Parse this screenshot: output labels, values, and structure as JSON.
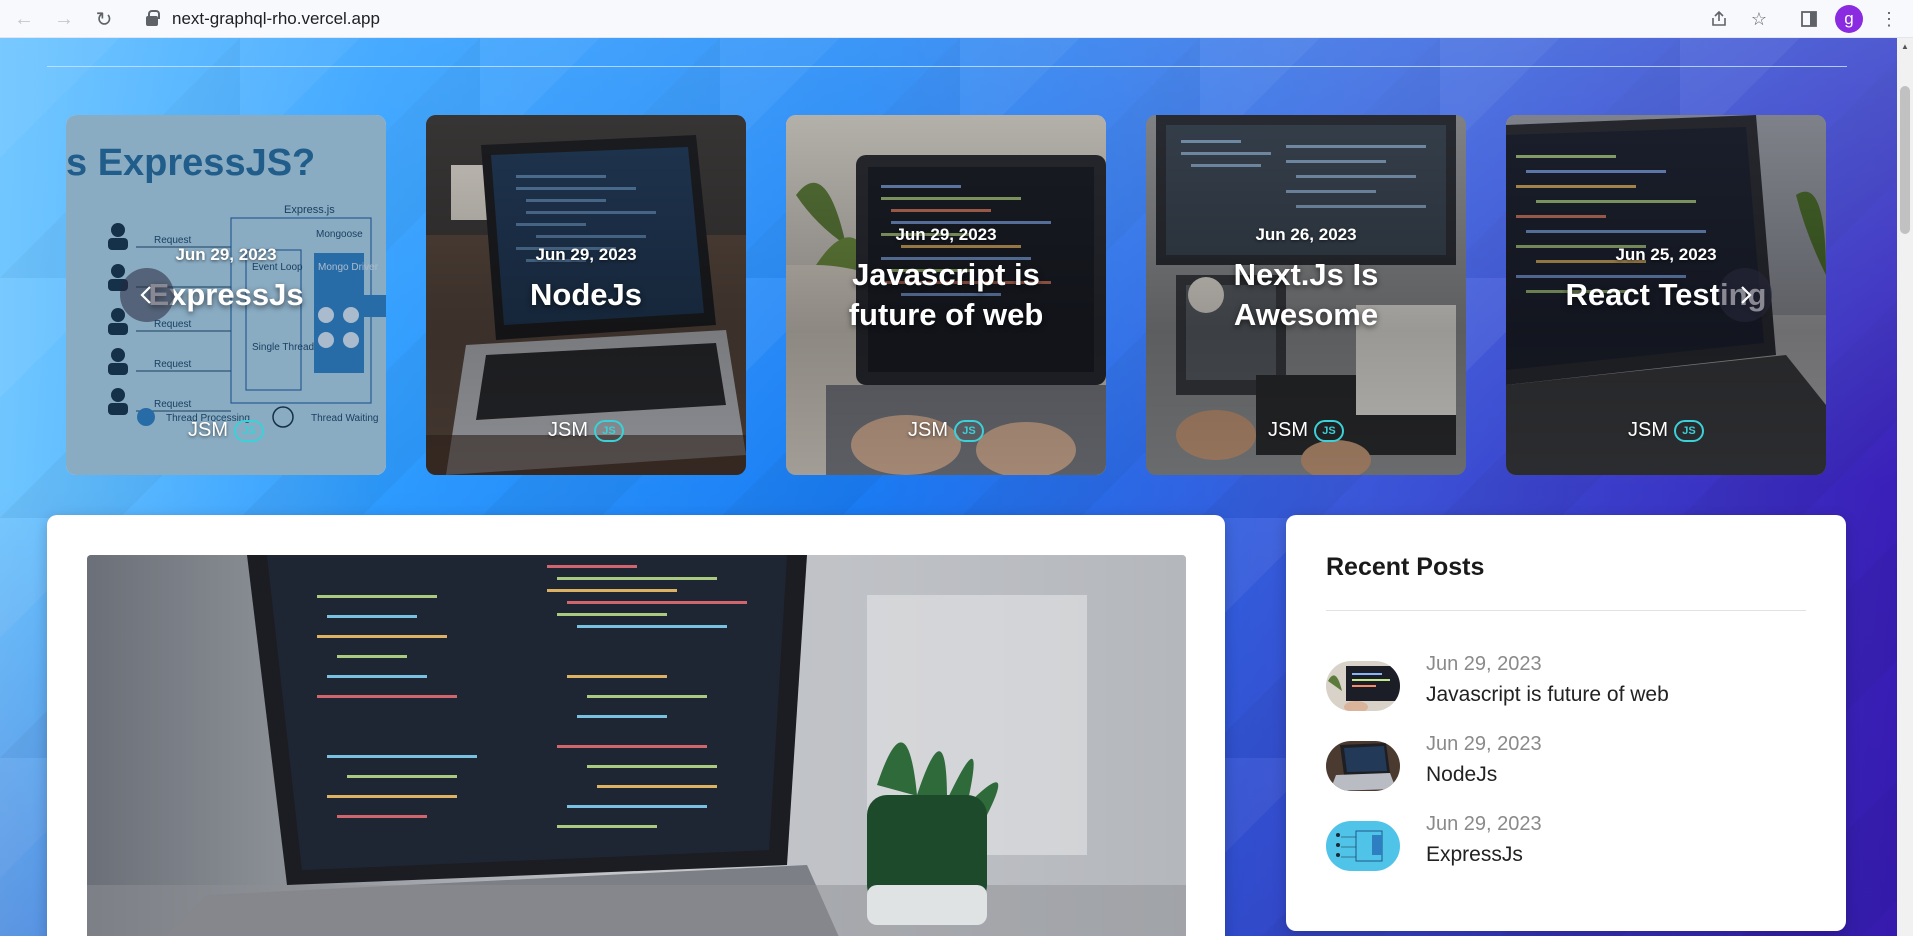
{
  "browser": {
    "url": "next-graphql-rho.vercel.app",
    "profile_initial": "g",
    "back_icon": "arrow-left-icon",
    "forward_icon": "arrow-right-icon",
    "reload_icon": "reload-icon"
  },
  "carousel": {
    "prev_icon": "chevron-left-icon",
    "next_icon": "chevron-right-icon",
    "cards": [
      {
        "date": "Jun 29, 2023",
        "title": "ExpressJs",
        "author": "JSM",
        "badge": "JS",
        "image": "expressjs-diagram"
      },
      {
        "date": "Jun 29, 2023",
        "title": "NodeJs",
        "author": "JSM",
        "badge": "JS",
        "image": "laptop-desk"
      },
      {
        "date": "Jun 29, 2023",
        "title": "Javascript is future of web",
        "author": "JSM",
        "badge": "JS",
        "image": "laptop-code-hands"
      },
      {
        "date": "Jun 26, 2023",
        "title": "Next.Js Is Awesome",
        "author": "JSM",
        "badge": "JS",
        "image": "monitors-desk"
      },
      {
        "date": "Jun 25, 2023",
        "title": "React Testing",
        "author": "JSM",
        "badge": "JS",
        "image": "laptop-code-side"
      }
    ],
    "express_diagram_text": {
      "heading": "s ExpressJS?",
      "label_top": "Express.js",
      "mongoose": "Mongoose",
      "event_loop": "Event Loop",
      "mongo_driver": "Mongo Driver",
      "single_thread": "Single Thread",
      "request": "Request",
      "thread_processing": "Thread Processing",
      "thread_waiting": "Thread Waiting"
    }
  },
  "featured": {
    "image": "laptop-with-plant"
  },
  "recent_posts": {
    "title": "Recent Posts",
    "items": [
      {
        "date": "Jun 29, 2023",
        "title": "Javascript is future of web",
        "thumb": "laptop-code-hands"
      },
      {
        "date": "Jun 29, 2023",
        "title": "NodeJs",
        "thumb": "laptop-desk"
      },
      {
        "date": "Jun 29, 2023",
        "title": "ExpressJs",
        "thumb": "expressjs-diagram"
      }
    ]
  },
  "colors": {
    "bg_left": "#6fc6ff",
    "bg_mid": "#1a7cf3",
    "bg_right": "#3a1fb8",
    "badge": "#3ad1d8",
    "avatar": "#8a2be2"
  }
}
